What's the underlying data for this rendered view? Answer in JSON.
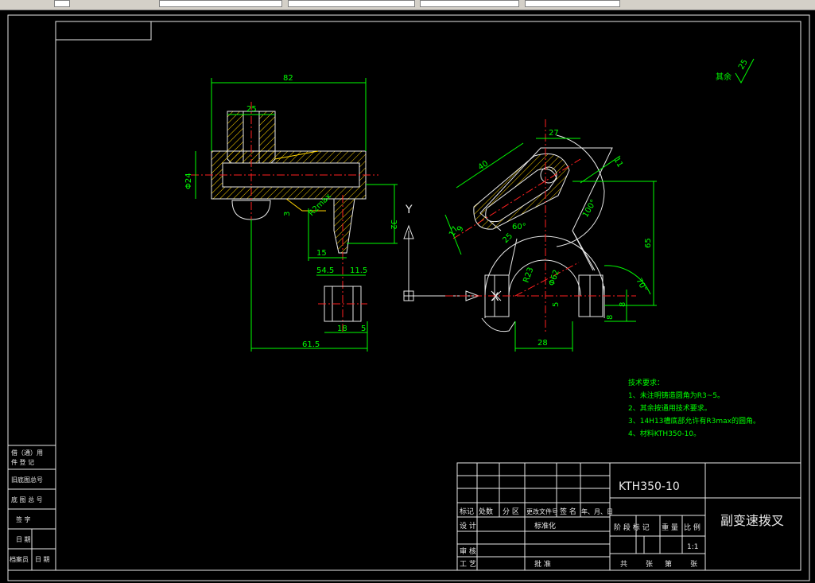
{
  "toolbar": {
    "fields": [
      "",
      "",
      "",
      "",
      ""
    ],
    "colors": {
      "bg": "#d4d0c8"
    }
  },
  "drawing": {
    "roughness": "其余",
    "roughness_value": "25",
    "dims_left": {
      "d82": "82",
      "d25": "25",
      "d24": "Φ24",
      "d32": "32",
      "d3": "3",
      "r": "R2max",
      "d15": "15",
      "d54": "54.5",
      "d115": "11.5",
      "d18": "18",
      "d5": "5",
      "d615": "61.5"
    },
    "dims_right": {
      "d40": "40",
      "d27": "27",
      "d11": "11",
      "d17": "17",
      "d9": "9",
      "d25": "25",
      "a60": "60°",
      "a100": "100°",
      "r23": "R23",
      "d62": "Φ62",
      "d5": "5",
      "d65": "65",
      "a70": "70°",
      "d8a": "8",
      "d8b": "8",
      "d28": "28"
    },
    "axis_y": "Y",
    "axis_x": "X",
    "tech_title": "技术要求：",
    "tech_items": [
      "1、未注明铸造圆角为R3~5。",
      "2、其余按通用技术要求。",
      "3、14H13槽底部允许有R3max的圆角。",
      "4、材料KTH350-10。"
    ]
  },
  "title_block": {
    "material": "KTH350-10",
    "part_name": "副变速拨叉",
    "scale": "1:1",
    "hdr": [
      "标记",
      "处数",
      "分 区",
      "更改文件号",
      "签 名",
      "年、月、日"
    ],
    "row_design": "设 计",
    "row_std": "标准化",
    "row_check": "审 核",
    "row_process": "工 艺",
    "row_approve": "批 准",
    "stage": "阶 段 标 记",
    "weight": "重 量",
    "ratio": "比 例",
    "sheets": [
      "共",
      "张",
      "第",
      "张"
    ]
  },
  "side_block": [
    "借（通）用",
    "件 登 记",
    "旧底图总号",
    "底 图 总 号",
    "签 字",
    "日 期",
    "档案员",
    "日 期"
  ]
}
